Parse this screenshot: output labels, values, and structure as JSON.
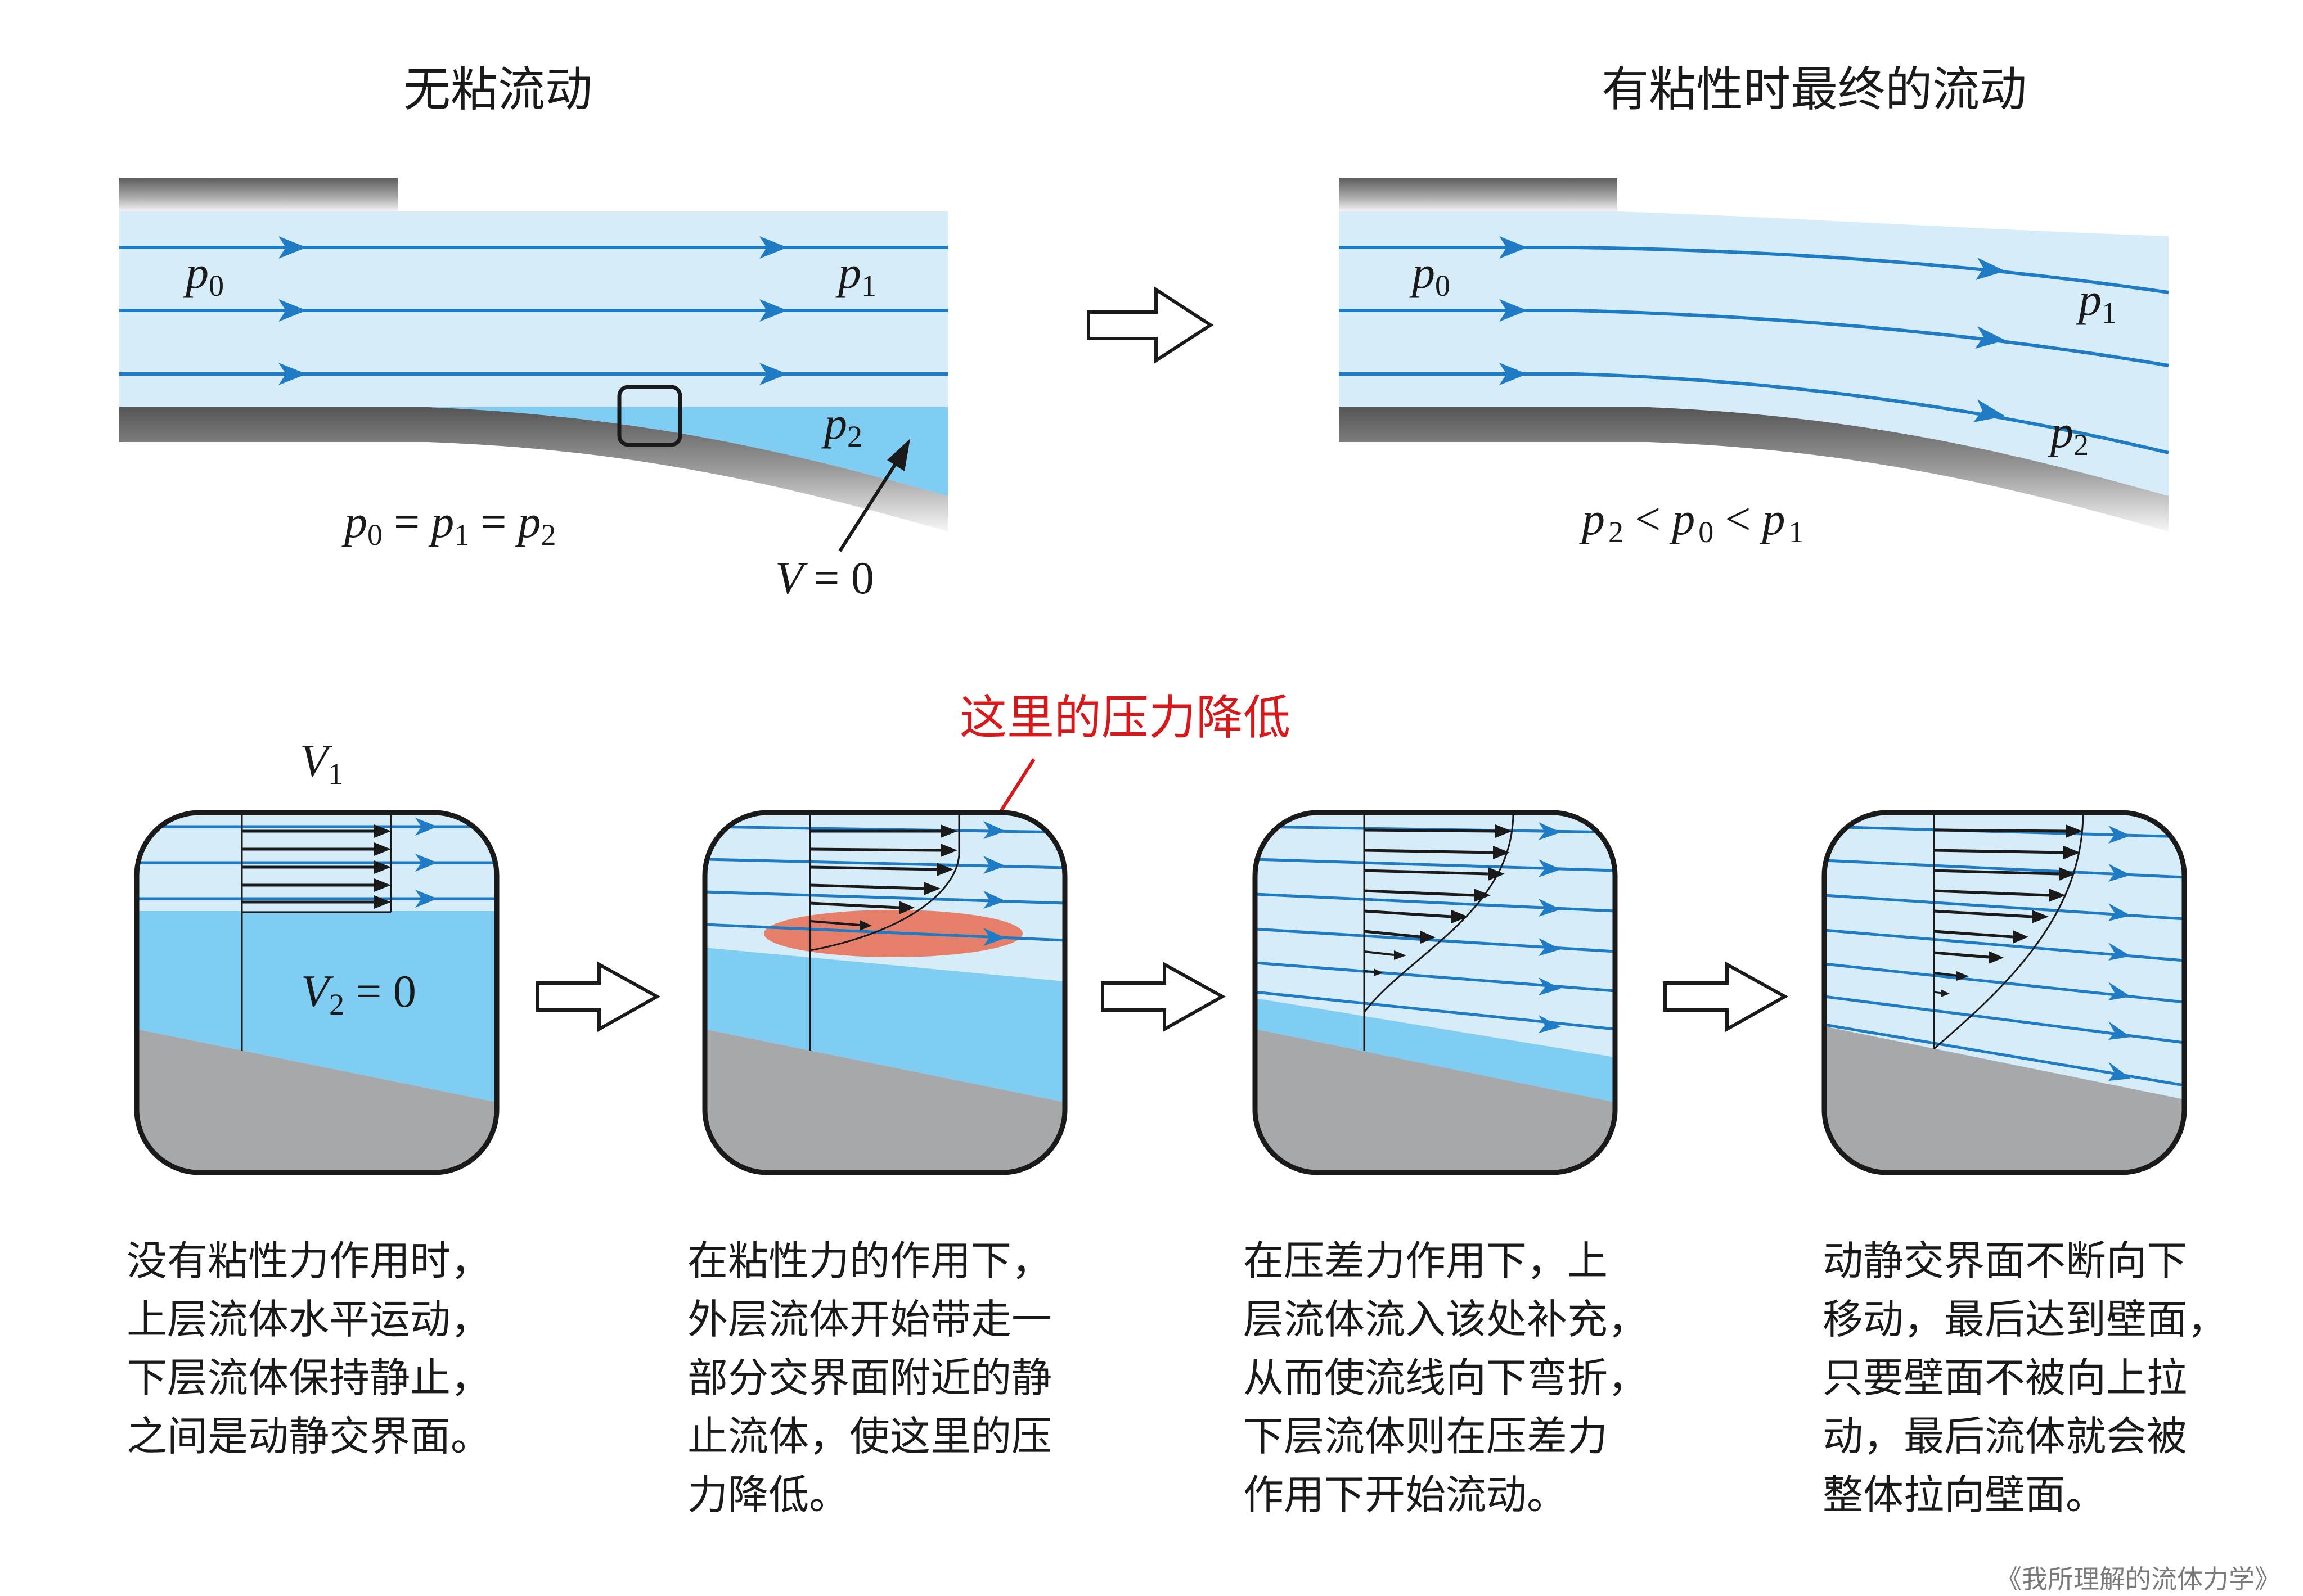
{
  "titles": {
    "inviscid": "无粘流动",
    "viscous_final": "有粘性时最终的流动"
  },
  "top_left": {
    "p0_base": "p",
    "p0_sub": "0",
    "p1_base": "p",
    "p1_sub": "1",
    "p2_base": "p",
    "p2_sub": "2",
    "equation": {
      "p": "p",
      "eq": "=",
      "s0": "0",
      "s1": "1",
      "s2": "2"
    },
    "velocity_label": {
      "v": "V",
      "rest": "= 0"
    }
  },
  "top_right": {
    "p0_base": "p",
    "p0_sub": "0",
    "p1_base": "p",
    "p1_sub": "1",
    "p2_base": "p",
    "p2_sub": "2",
    "inequality": {
      "p": "p",
      "lt": "<",
      "s0": "0",
      "s1": "1",
      "s2": "2"
    }
  },
  "callout": "这里的压力降低",
  "panel1": {
    "v1": {
      "base": "V",
      "sub": "1"
    },
    "v2": {
      "base": "V",
      "sub": "2",
      "rest": "= 0"
    }
  },
  "captions": [
    [
      "没有粘性力作用时，",
      "上层流体水平运动，",
      "下层流体保持静止，",
      "之间是动静交界面。"
    ],
    [
      "在粘性力的作用下，",
      "外层流体开始带走一",
      "部分交界面附近的静",
      "止流体，使这里的压",
      "力降低。"
    ],
    [
      "在压差力作用下，上",
      "层流体流入该处补充，",
      "从而使流线向下弯折，",
      "下层流体则在压差力",
      "作用下开始流动。"
    ],
    [
      "动静交界面不断向下",
      "移动，最后达到壁面，",
      "只要壁面不被向上拉",
      "动，最后流体就会被",
      "整体拉向壁面。"
    ]
  ],
  "watermark": "《我所理解的流体力学》",
  "colors": {
    "fluid_light": "#d6ecf8",
    "fluid_dead": "#7fcdf2",
    "streamline": "#1f7bc4",
    "wall_gray": "#a7a8aa",
    "callout_red": "#d7191c",
    "low_pressure": "#e8735a"
  }
}
